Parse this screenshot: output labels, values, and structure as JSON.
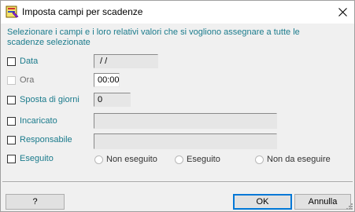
{
  "window": {
    "title": "Imposta campi per scadenze",
    "app_icon": "app-icon",
    "close_icon": "close-icon"
  },
  "instructions": "Selezionare i campi e i loro relativi valori che si vogliono assegnare a tutte le scadenze selezionate",
  "fields": {
    "data": {
      "label": "Data",
      "value": " / /",
      "checked": false
    },
    "ora": {
      "label": "Ora",
      "value": "00:00",
      "checked": false,
      "disabled": true
    },
    "sposta": {
      "label": "Sposta di giorni",
      "value": "0",
      "checked": false
    },
    "incaricato": {
      "label": "Incaricato",
      "value": "",
      "checked": false
    },
    "responsabile": {
      "label": "Responsabile",
      "value": "",
      "checked": false
    },
    "eseguito": {
      "label": "Eseguito",
      "checked": false,
      "options": [
        "Non eseguito",
        "Eseguito",
        "Non da eseguire"
      ]
    }
  },
  "buttons": {
    "help": "?",
    "ok": "OK",
    "cancel": "Annulla"
  },
  "colors": {
    "label_teal": "#1b7b8c",
    "default_button_border": "#0078d7"
  }
}
